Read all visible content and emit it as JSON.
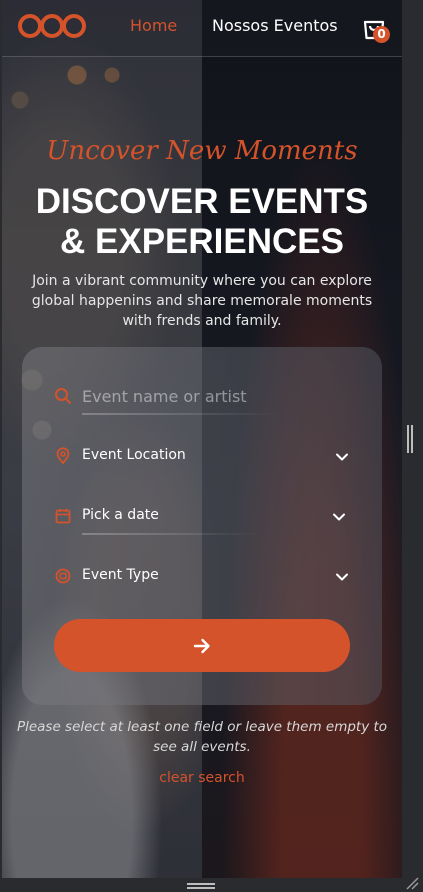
{
  "header": {
    "logo_name": "brand-logo",
    "nav": [
      {
        "label": "Home",
        "active": true
      },
      {
        "label": "Nossos Eventos",
        "active": false
      }
    ],
    "cart_count": "0"
  },
  "hero": {
    "tagline": "Uncover New Moments",
    "title_line1": "DISCOVER EVENTS",
    "title_line2": "& EXPERIENCES",
    "subtitle": "Join a vibrant community where you can explore global happenins and share memorale moments with frends and family."
  },
  "search": {
    "name_placeholder": "Event name or artist",
    "location_label": "Event Location",
    "date_label": "Pick a date",
    "type_label": "Event Type",
    "submit_icon": "arrow-right-icon"
  },
  "help_text": "Please select at least one field or leave them empty to see all events.",
  "clear_label": "clear search",
  "colors": {
    "accent": "#d4532a",
    "text": "#ffffff",
    "card": "#6e7078"
  }
}
